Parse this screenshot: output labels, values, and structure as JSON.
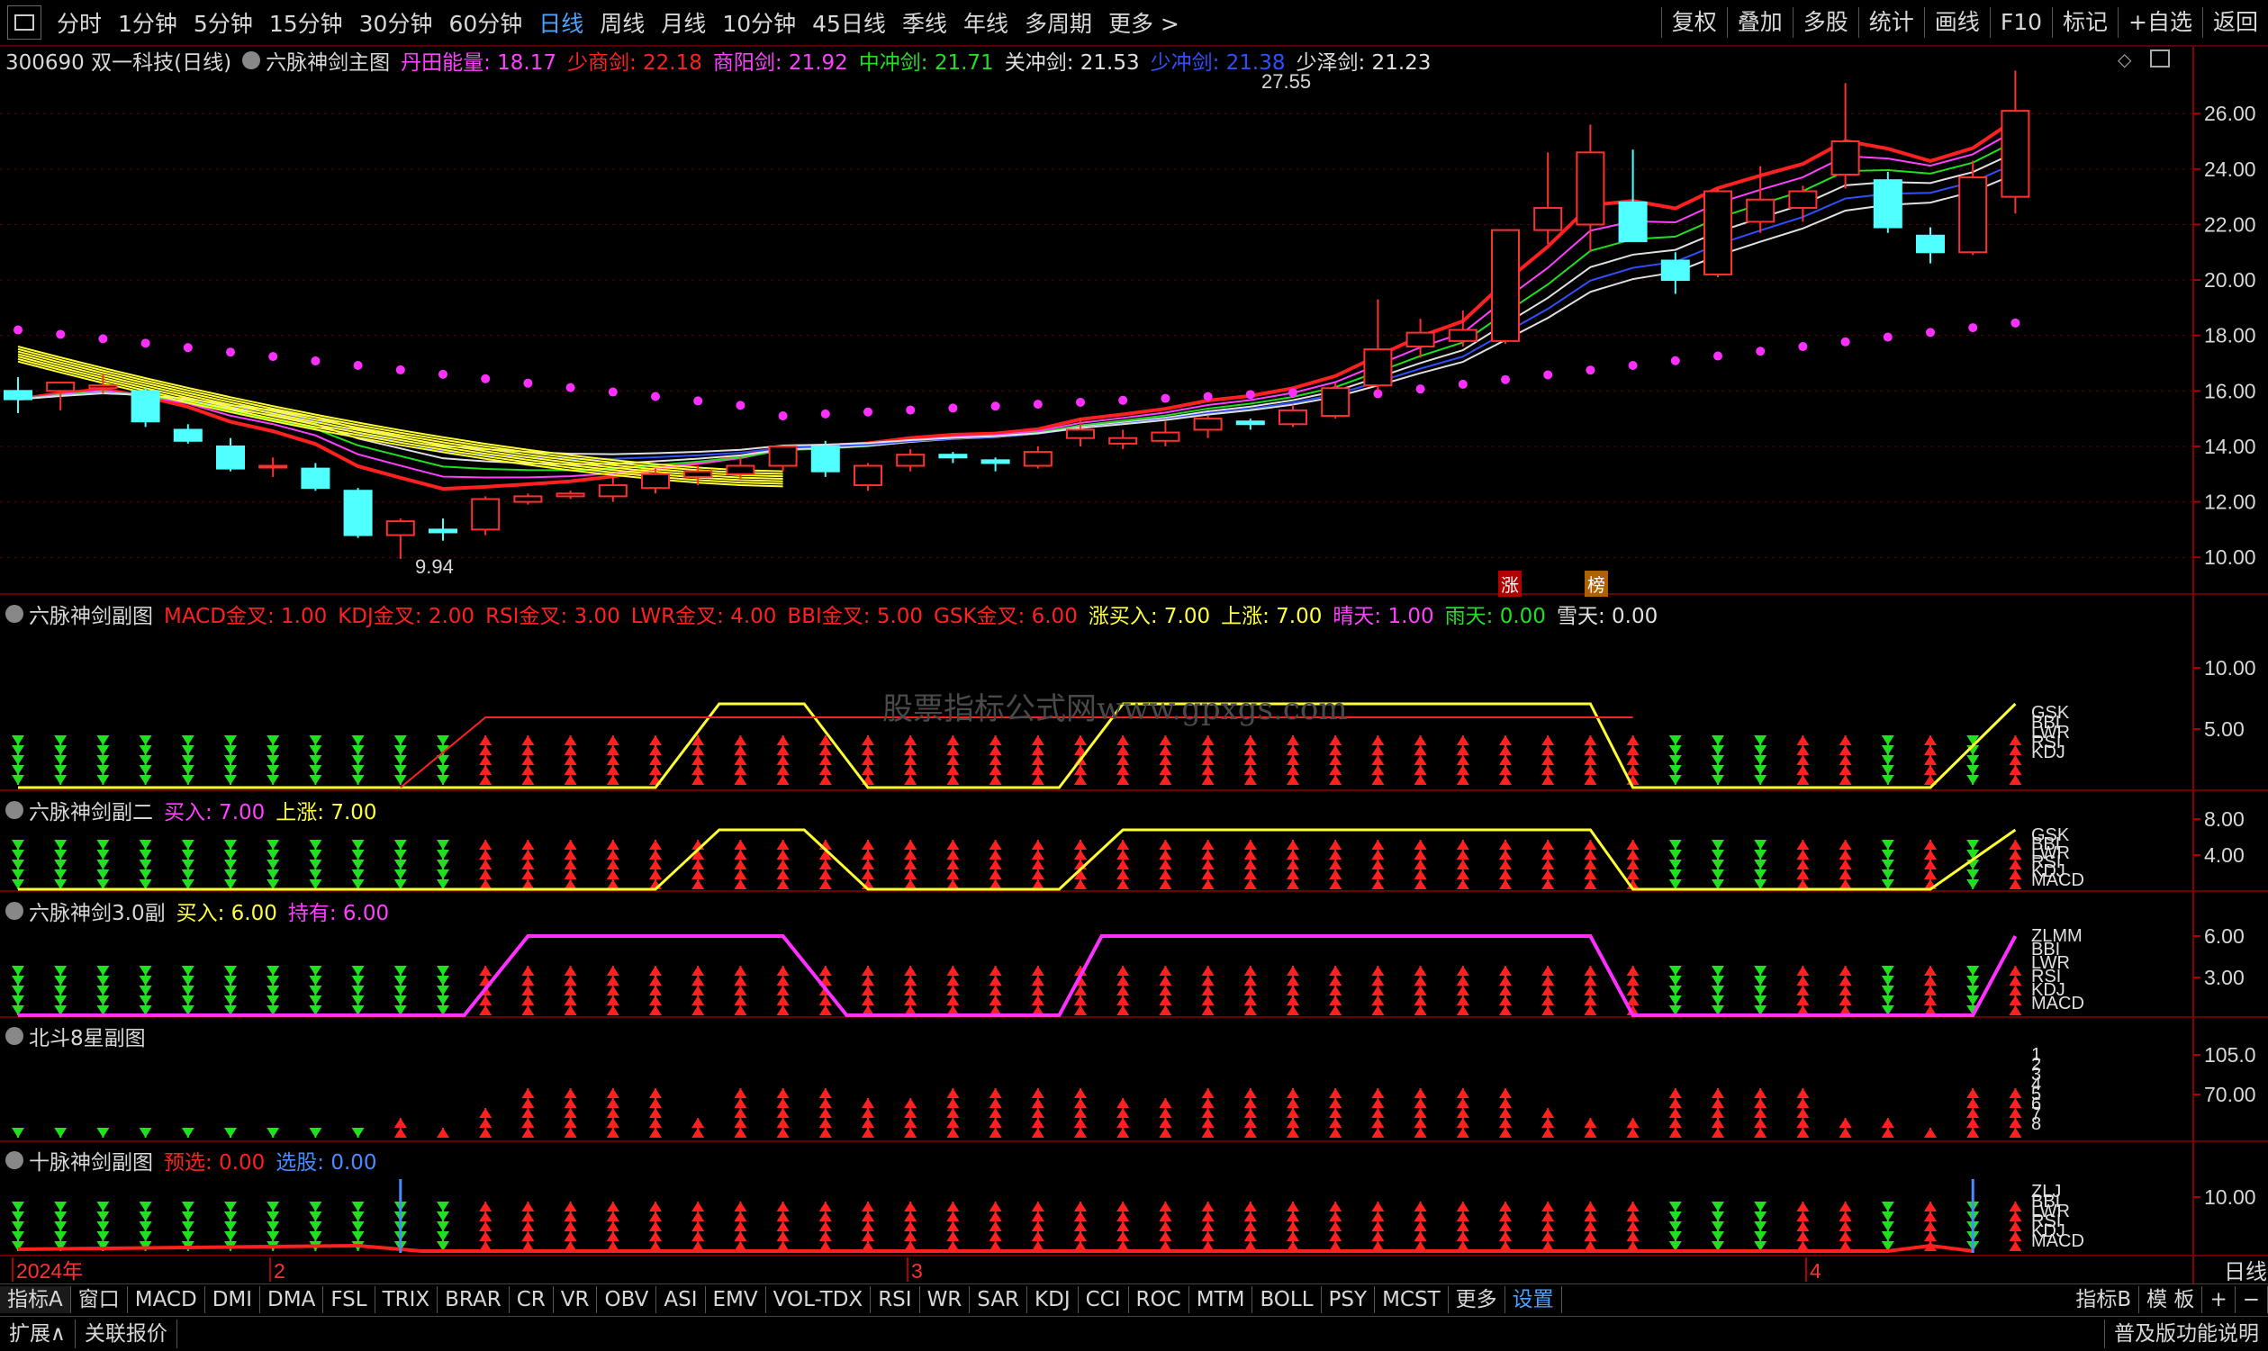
{
  "toolbar": {
    "periods": [
      "分时",
      "1分钟",
      "5分钟",
      "15分钟",
      "30分钟",
      "60分钟",
      "日线",
      "周线",
      "月线",
      "10分钟",
      "45日线",
      "季线",
      "年线",
      "多周期",
      "更多 >"
    ],
    "active_period": "日线",
    "right_buttons": [
      "复权",
      "叠加",
      "多股",
      "统计",
      "画线",
      "F10",
      "标记",
      "+自选",
      "返回"
    ]
  },
  "stock": {
    "code_name": "300690 双一科技(日线)",
    "main_indicator": "六脉神剑主图",
    "values": [
      {
        "label": "丹田能量: 18.17",
        "color": "#ff40ff"
      },
      {
        "label": "少商剑: 22.18",
        "color": "#ff2020"
      },
      {
        "label": "商阳剑: 21.92",
        "color": "#ff40ff"
      },
      {
        "label": "中冲剑: 21.71",
        "color": "#20e020"
      },
      {
        "label": "关冲剑: 21.53",
        "color": "#e0e0e0"
      },
      {
        "label": "少冲剑: 21.38",
        "color": "#3050ff"
      },
      {
        "label": "少泽剑: 21.23",
        "color": "#e0e0e0"
      }
    ],
    "high_label": "27.55",
    "low_label": "9.94",
    "tag_zhang": "涨",
    "tag_bang": "榜"
  },
  "price_axis": [
    "26.00",
    "24.00",
    "22.00",
    "20.00",
    "18.00",
    "16.00",
    "14.00",
    "12.00",
    "10.00"
  ],
  "sub1": {
    "title": "六脉神剑副图",
    "values": [
      {
        "label": "MACD金叉: 1.00",
        "color": "#ff2020"
      },
      {
        "label": "KDJ金叉: 2.00",
        "color": "#ff2020"
      },
      {
        "label": "RSI金叉: 3.00",
        "color": "#ff2020"
      },
      {
        "label": "LWR金叉: 4.00",
        "color": "#ff2020"
      },
      {
        "label": "BBI金叉: 5.00",
        "color": "#ff2020"
      },
      {
        "label": "GSK金叉: 6.00",
        "color": "#ff2020"
      },
      {
        "label": "涨买入: 7.00",
        "color": "#ffff40"
      },
      {
        "label": "上涨: 7.00",
        "color": "#ffff40"
      },
      {
        "label": "晴天: 1.00",
        "color": "#ff40ff"
      },
      {
        "label": "雨天: 0.00",
        "color": "#20e020"
      },
      {
        "label": "雪天: 0.00",
        "color": "#e0e0e0"
      }
    ],
    "axis": [
      "10.00",
      "5.00"
    ],
    "side_labels": [
      "GSK",
      "BBI",
      "LWR",
      "RSI",
      "KDJ"
    ]
  },
  "sub2": {
    "title": "六脉神剑副二",
    "values": [
      {
        "label": "买入: 7.00",
        "color": "#ff40ff"
      },
      {
        "label": "上涨: 7.00",
        "color": "#ffff40"
      }
    ],
    "axis": [
      "8.00",
      "4.00"
    ],
    "side_labels": [
      "GSK",
      "BBI",
      "LWR",
      "RSI",
      "KDJ",
      "MACD"
    ]
  },
  "sub3": {
    "title": "六脉神剑3.0副",
    "values": [
      {
        "label": "买入: 6.00",
        "color": "#ffff40"
      },
      {
        "label": "持有: 6.00",
        "color": "#ff40ff"
      }
    ],
    "axis": [
      "6.00",
      "3.00"
    ],
    "side_labels": [
      "ZLMM",
      "BBI",
      "LWR",
      "RSI",
      "KDJ",
      "MACD"
    ]
  },
  "sub4": {
    "title": "北斗8星副图",
    "values": [],
    "axis": [
      "105.0",
      "70.00"
    ],
    "side_labels": [
      "1",
      "2",
      "3",
      "4",
      "5",
      "6",
      "7",
      "8"
    ]
  },
  "sub5": {
    "title": "十脉神剑副图",
    "values": [
      {
        "label": "预选: 0.00",
        "color": "#ff2020"
      },
      {
        "label": "选股: 0.00",
        "color": "#4a8cff"
      }
    ],
    "axis": [
      "10.00"
    ],
    "side_labels": [
      "ZLJ",
      "BBI",
      "LWR",
      "RSI",
      "KDJ",
      "MACD"
    ]
  },
  "date_axis": [
    "2024年",
    "2",
    "3",
    "4"
  ],
  "date_right": "日线",
  "watermark": "股票指标公式网www.gpxgs.com",
  "bottom_tabs": [
    "指标A",
    "窗口",
    "MACD",
    "DMI",
    "DMA",
    "FSL",
    "TRIX",
    "BRAR",
    "CR",
    "VR",
    "OBV",
    "ASI",
    "EMV",
    "VOL-TDX",
    "RSI",
    "WR",
    "SAR",
    "KDJ",
    "CCI",
    "ROC",
    "MTM",
    "BOLL",
    "PSY",
    "MCST",
    "更多",
    "设置"
  ],
  "bottom_right_tabs": [
    "指标B",
    "模 板",
    "+",
    "−"
  ],
  "status_left": [
    "扩展∧",
    "关联报价"
  ],
  "status_right": "普及版功能说明",
  "chart_data": {
    "type": "candlestick",
    "ylim": [
      9,
      27.5
    ],
    "candles": [
      {
        "o": 16.0,
        "h": 16.5,
        "l": 15.2,
        "c": 15.7
      },
      {
        "o": 16.0,
        "h": 16.3,
        "l": 15.3,
        "c": 16.3
      },
      {
        "o": 16.1,
        "h": 16.6,
        "l": 15.9,
        "c": 16.2
      },
      {
        "o": 16.0,
        "h": 16.1,
        "l": 14.7,
        "c": 14.9
      },
      {
        "o": 14.6,
        "h": 14.8,
        "l": 14.1,
        "c": 14.2
      },
      {
        "o": 14.0,
        "h": 14.3,
        "l": 13.1,
        "c": 13.2
      },
      {
        "o": 13.3,
        "h": 13.6,
        "l": 12.9,
        "c": 13.3
      },
      {
        "o": 13.2,
        "h": 13.4,
        "l": 12.4,
        "c": 12.5
      },
      {
        "o": 12.4,
        "h": 12.5,
        "l": 10.7,
        "c": 10.8
      },
      {
        "o": 10.8,
        "h": 11.4,
        "l": 9.94,
        "c": 11.3
      },
      {
        "o": 11.0,
        "h": 11.4,
        "l": 10.6,
        "c": 10.9
      },
      {
        "o": 11.0,
        "h": 12.2,
        "l": 10.8,
        "c": 12.1
      },
      {
        "o": 12.0,
        "h": 12.3,
        "l": 11.9,
        "c": 12.2
      },
      {
        "o": 12.2,
        "h": 12.4,
        "l": 12.1,
        "c": 12.3
      },
      {
        "o": 12.2,
        "h": 12.9,
        "l": 12.0,
        "c": 12.6
      },
      {
        "o": 12.5,
        "h": 13.2,
        "l": 12.3,
        "c": 13.0
      },
      {
        "o": 12.9,
        "h": 13.3,
        "l": 12.6,
        "c": 13.1
      },
      {
        "o": 13.0,
        "h": 13.6,
        "l": 12.8,
        "c": 13.3
      },
      {
        "o": 13.3,
        "h": 14.0,
        "l": 13.1,
        "c": 14.0
      },
      {
        "o": 14.0,
        "h": 14.2,
        "l": 12.9,
        "c": 13.1
      },
      {
        "o": 12.6,
        "h": 13.4,
        "l": 12.4,
        "c": 13.3
      },
      {
        "o": 13.3,
        "h": 13.9,
        "l": 13.1,
        "c": 13.7
      },
      {
        "o": 13.7,
        "h": 13.8,
        "l": 13.4,
        "c": 13.6
      },
      {
        "o": 13.5,
        "h": 13.6,
        "l": 13.1,
        "c": 13.4
      },
      {
        "o": 13.3,
        "h": 14.0,
        "l": 13.2,
        "c": 13.8
      },
      {
        "o": 14.3,
        "h": 15.0,
        "l": 14.0,
        "c": 14.6
      },
      {
        "o": 14.1,
        "h": 14.6,
        "l": 13.9,
        "c": 14.3
      },
      {
        "o": 14.2,
        "h": 14.9,
        "l": 14.0,
        "c": 14.5
      },
      {
        "o": 14.6,
        "h": 15.1,
        "l": 14.3,
        "c": 15.0
      },
      {
        "o": 14.9,
        "h": 15.0,
        "l": 14.6,
        "c": 14.8
      },
      {
        "o": 14.8,
        "h": 15.5,
        "l": 14.7,
        "c": 15.3
      },
      {
        "o": 15.1,
        "h": 16.3,
        "l": 15.0,
        "c": 16.1
      },
      {
        "o": 16.2,
        "h": 19.3,
        "l": 16.0,
        "c": 17.5
      },
      {
        "o": 17.6,
        "h": 18.6,
        "l": 17.2,
        "c": 18.1
      },
      {
        "o": 17.8,
        "h": 18.9,
        "l": 17.6,
        "c": 18.2
      },
      {
        "o": 17.8,
        "h": 21.8,
        "l": 17.7,
        "c": 21.8
      },
      {
        "o": 21.8,
        "h": 24.6,
        "l": 21.3,
        "c": 22.6
      },
      {
        "o": 22.0,
        "h": 25.6,
        "l": 21.0,
        "c": 24.6
      },
      {
        "o": 22.8,
        "h": 24.7,
        "l": 21.4,
        "c": 21.4
      },
      {
        "o": 20.7,
        "h": 21.0,
        "l": 19.5,
        "c": 20.0
      },
      {
        "o": 20.2,
        "h": 23.3,
        "l": 20.1,
        "c": 23.2
      },
      {
        "o": 22.1,
        "h": 24.1,
        "l": 21.7,
        "c": 22.9
      },
      {
        "o": 22.6,
        "h": 23.4,
        "l": 22.1,
        "c": 23.2
      },
      {
        "o": 23.8,
        "h": 27.1,
        "l": 23.3,
        "c": 25.0
      },
      {
        "o": 23.6,
        "h": 23.9,
        "l": 21.7,
        "c": 21.9
      },
      {
        "o": 21.6,
        "h": 21.9,
        "l": 20.6,
        "c": 21.0
      },
      {
        "o": 21.0,
        "h": 24.3,
        "l": 20.9,
        "c": 23.7
      },
      {
        "o": 23.0,
        "h": 27.55,
        "l": 22.4,
        "c": 26.1
      }
    ]
  }
}
